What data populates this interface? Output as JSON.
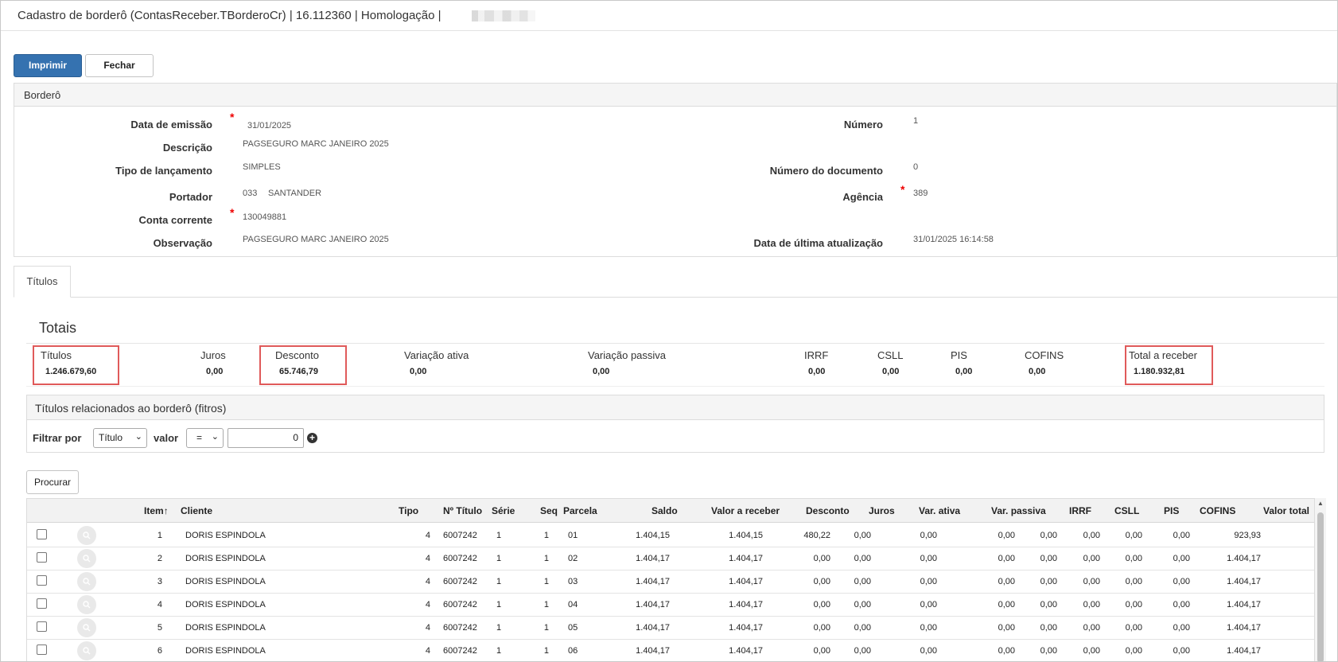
{
  "window": {
    "title": "Cadastro de borderô (ContasReceber.TBorderoCr) | 16.112360 | Homologação | "
  },
  "toolbar": {
    "print_label": "Imprimir",
    "close_label": "Fechar"
  },
  "bordero": {
    "section_title": "Borderô",
    "fields": {
      "data_emissao": {
        "label": "Data de emissão",
        "value": "31/01/2025"
      },
      "descricao": {
        "label": "Descrição",
        "value": "PAGSEGURO MARC JANEIRO 2025"
      },
      "tipo_lancamento": {
        "label": "Tipo de lançamento",
        "value": "SIMPLES"
      },
      "portador": {
        "label": "Portador",
        "code": "033",
        "value": "SANTANDER"
      },
      "conta_corrente": {
        "label": "Conta corrente",
        "value": "130049881"
      },
      "observacao": {
        "label": "Observação",
        "value": "PAGSEGURO MARC JANEIRO 2025"
      },
      "numero": {
        "label": "Número",
        "value": "1"
      },
      "numero_documento": {
        "label": "Número do documento",
        "value": "0"
      },
      "agencia": {
        "label": "Agência",
        "value": "389"
      },
      "data_ultima_atualizacao": {
        "label": "Data de última atualização",
        "value": "31/01/2025 16:14:58"
      }
    },
    "required_mark": "*"
  },
  "tabs": [
    {
      "label": "Títulos",
      "active": true
    }
  ],
  "totais": {
    "title": "Totais",
    "items": [
      {
        "label": "Títulos",
        "value": "1.246.679,60"
      },
      {
        "label": "Juros",
        "value": "0,00"
      },
      {
        "label": "Desconto",
        "value": "65.746,79"
      },
      {
        "label": "Variação ativa",
        "value": "0,00"
      },
      {
        "label": "Variação passiva",
        "value": "0,00"
      },
      {
        "label": "IRRF",
        "value": "0,00"
      },
      {
        "label": "CSLL",
        "value": "0,00"
      },
      {
        "label": "PIS",
        "value": "0,00"
      },
      {
        "label": "COFINS",
        "value": "0,00"
      },
      {
        "label": "Total a receber",
        "value": "1.180.932,81"
      }
    ]
  },
  "filtros": {
    "title": "Títulos relacionados ao borderô (fitros)",
    "filter_by_label": "Filtrar por",
    "filter_field_selected": "Título",
    "value_label": "valor",
    "operator_selected": "=",
    "value": "0",
    "search_label": "Procurar"
  },
  "grid": {
    "columns": [
      "Item",
      "Cliente",
      "Tipo",
      "Nº Título",
      "Série",
      "Seq",
      "Parcela",
      "Saldo",
      "Valor a receber",
      "Desconto",
      "Juros",
      "Var. ativa",
      "Var. passiva",
      "IRRF",
      "CSLL",
      "PIS",
      "COFINS",
      "Valor total"
    ],
    "sort_indicator": "↑",
    "rows": [
      [
        "1",
        "DORIS ESPINDOLA",
        "4",
        "6007242",
        "1",
        "1",
        "01",
        "1.404,15",
        "1.404,15",
        "480,22",
        "0,00",
        "0,00",
        "0,00",
        "0,00",
        "0,00",
        "0,00",
        "0,00",
        "923,93"
      ],
      [
        "2",
        "DORIS ESPINDOLA",
        "4",
        "6007242",
        "1",
        "1",
        "02",
        "1.404,17",
        "1.404,17",
        "0,00",
        "0,00",
        "0,00",
        "0,00",
        "0,00",
        "0,00",
        "0,00",
        "0,00",
        "1.404,17"
      ],
      [
        "3",
        "DORIS ESPINDOLA",
        "4",
        "6007242",
        "1",
        "1",
        "03",
        "1.404,17",
        "1.404,17",
        "0,00",
        "0,00",
        "0,00",
        "0,00",
        "0,00",
        "0,00",
        "0,00",
        "0,00",
        "1.404,17"
      ],
      [
        "4",
        "DORIS ESPINDOLA",
        "4",
        "6007242",
        "1",
        "1",
        "04",
        "1.404,17",
        "1.404,17",
        "0,00",
        "0,00",
        "0,00",
        "0,00",
        "0,00",
        "0,00",
        "0,00",
        "0,00",
        "1.404,17"
      ],
      [
        "5",
        "DORIS ESPINDOLA",
        "4",
        "6007242",
        "1",
        "1",
        "05",
        "1.404,17",
        "1.404,17",
        "0,00",
        "0,00",
        "0,00",
        "0,00",
        "0,00",
        "0,00",
        "0,00",
        "0,00",
        "1.404,17"
      ],
      [
        "6",
        "DORIS ESPINDOLA",
        "4",
        "6007242",
        "1",
        "1",
        "06",
        "1.404,17",
        "1.404,17",
        "0,00",
        "0,00",
        "0,00",
        "0,00",
        "0,00",
        "0,00",
        "0,00",
        "0,00",
        "1.404,17"
      ]
    ]
  },
  "colors": {
    "primary": "#3572b0",
    "required": "#ee0000",
    "highlight": "#e05a5a"
  }
}
